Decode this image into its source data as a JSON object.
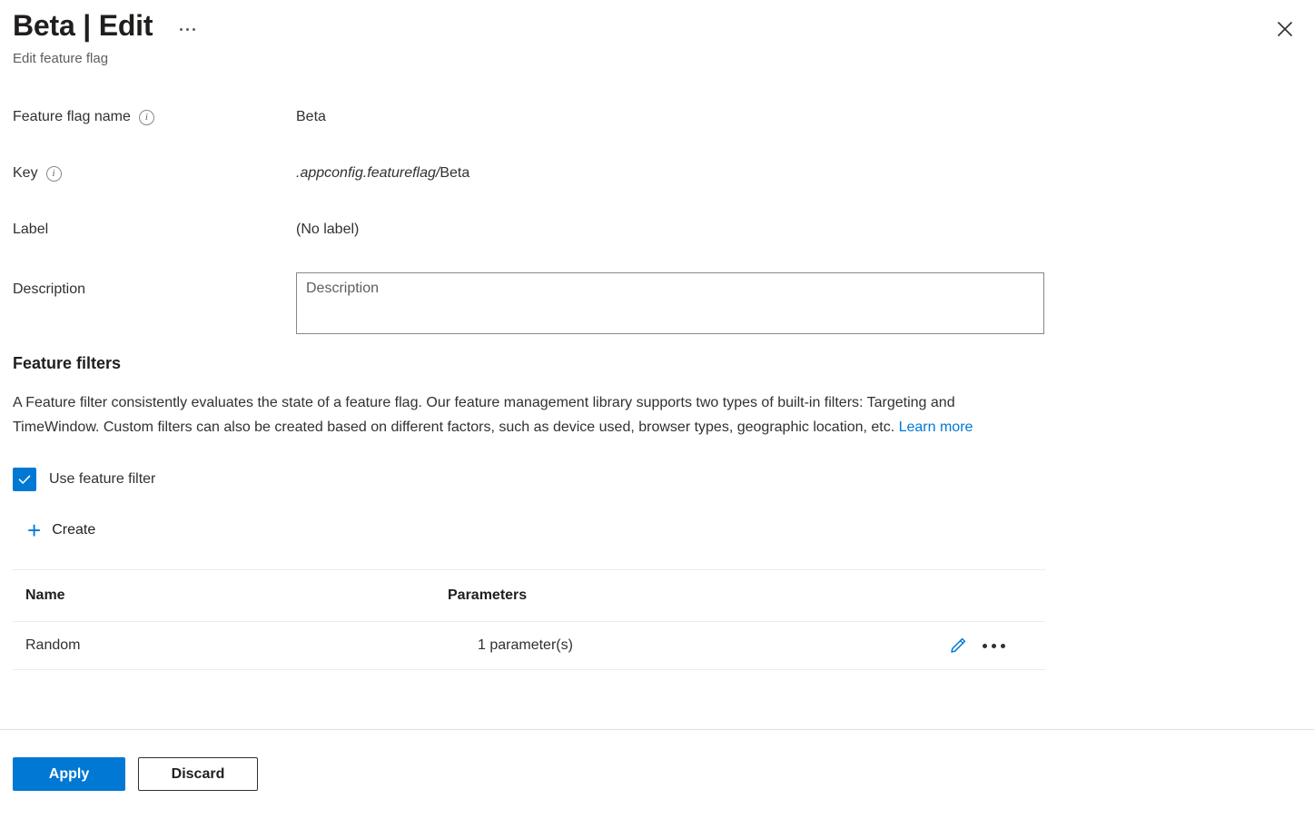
{
  "header": {
    "title": "Beta | Edit",
    "subtitle": "Edit feature flag",
    "more_menu_label": "More commands",
    "close_label": "Close"
  },
  "form": {
    "rows": [
      {
        "label": "Feature flag name",
        "has_info": true,
        "value": "Beta"
      },
      {
        "label": "Key",
        "has_info": true,
        "value_prefix": ".appconfig.featureflag/",
        "value_suffix": "Beta"
      },
      {
        "label": "Label",
        "has_info": false,
        "value": "(No label)"
      },
      {
        "label": "Description",
        "has_info": false,
        "placeholder": "Description",
        "value": ""
      }
    ]
  },
  "feature_filters": {
    "heading": "Feature filters",
    "description": "A Feature filter consistently evaluates the state of a feature flag. Our feature management library supports two types of built-in filters: Targeting and TimeWindow. Custom filters can also be created based on different factors, such as device used, browser types, geographic location, etc. ",
    "learn_more": "Learn more",
    "checkbox_label": "Use feature filter",
    "checkbox_checked": true,
    "create_label": "Create",
    "table": {
      "columns": [
        "Name",
        "Parameters"
      ],
      "rows": [
        {
          "name": "Random",
          "parameters": "1 parameter(s)",
          "edit_label": "Edit",
          "more_label": "More"
        }
      ]
    }
  },
  "footer": {
    "apply_label": "Apply",
    "discard_label": "Discard"
  },
  "colors": {
    "accent": "#0078d4",
    "text": "#323130",
    "muted": "#605e5c",
    "border": "#edebe9"
  }
}
